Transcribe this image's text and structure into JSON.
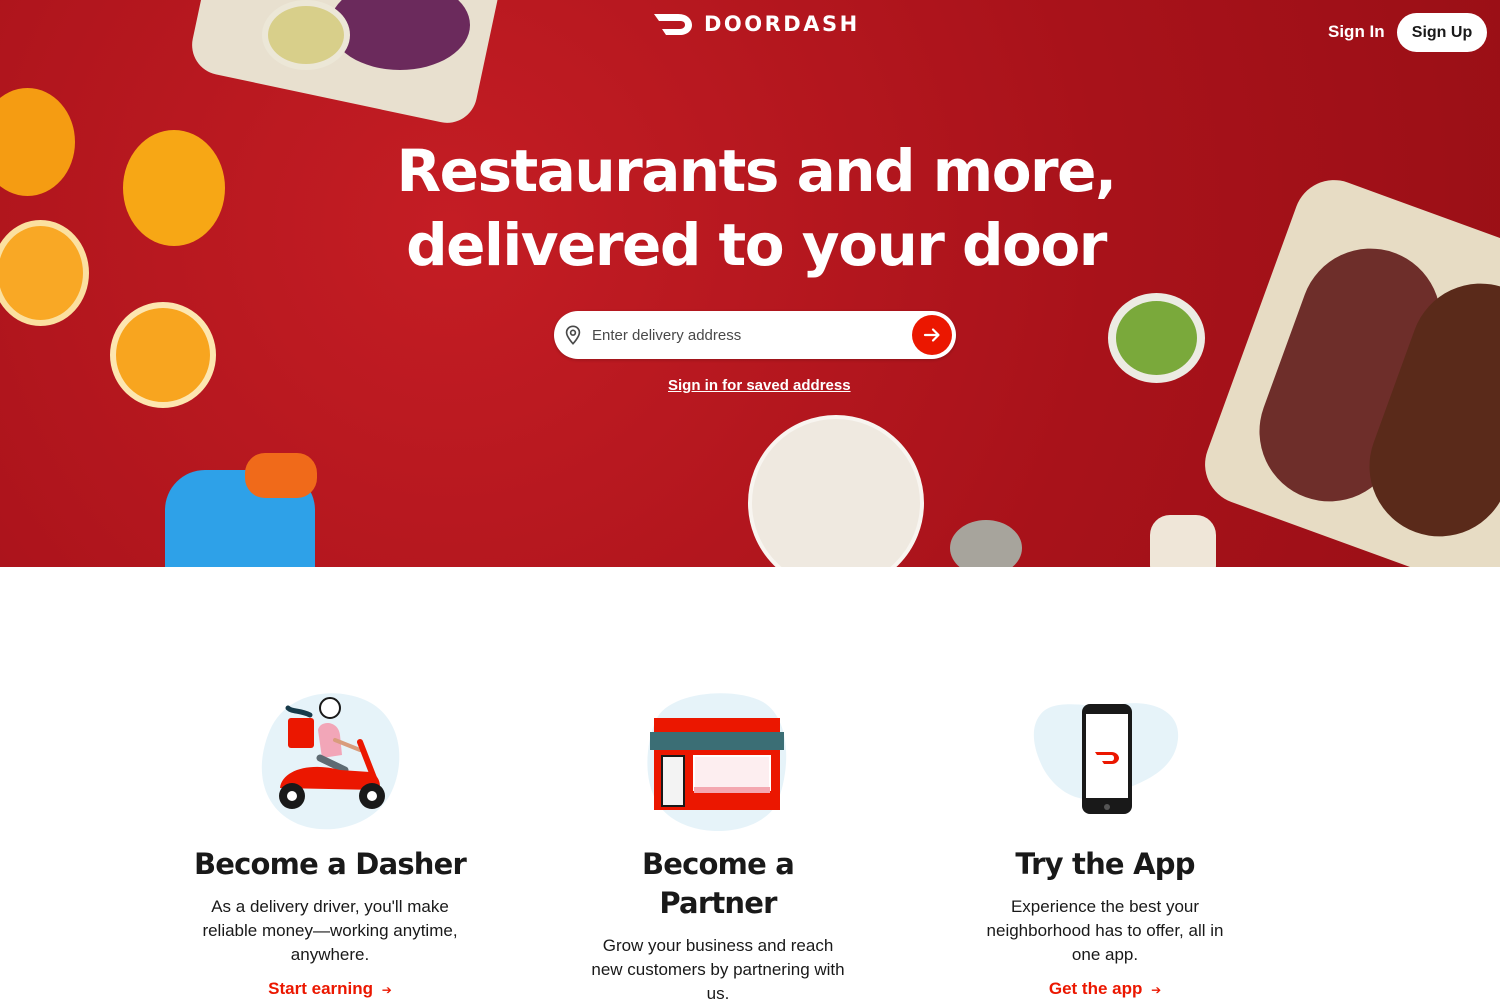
{
  "brand": {
    "name": "DOORDASH",
    "color": "#eb1700"
  },
  "header": {
    "sign_in": "Sign In",
    "sign_up": "Sign Up"
  },
  "hero": {
    "headline_line1": "Restaurants and more,",
    "headline_line2": "delivered to your door",
    "search_placeholder": "Enter delivery address",
    "saved_address_link": "Sign in for saved address",
    "background_color": "#b5141b"
  },
  "cards": [
    {
      "title": "Become a Dasher",
      "body": "As a delivery driver, you'll make reliable money—working anytime, anywhere.",
      "cta": "Start earning",
      "icon": "scooter-rider-icon"
    },
    {
      "title": "Become a Partner",
      "body": "Grow your business and reach new customers by partnering with us.",
      "cta": "",
      "icon": "storefront-icon"
    },
    {
      "title": "Try the App",
      "body": "Experience the best your neighborhood has to offer, all in one app.",
      "cta": "Get the app",
      "icon": "phone-app-icon"
    }
  ]
}
